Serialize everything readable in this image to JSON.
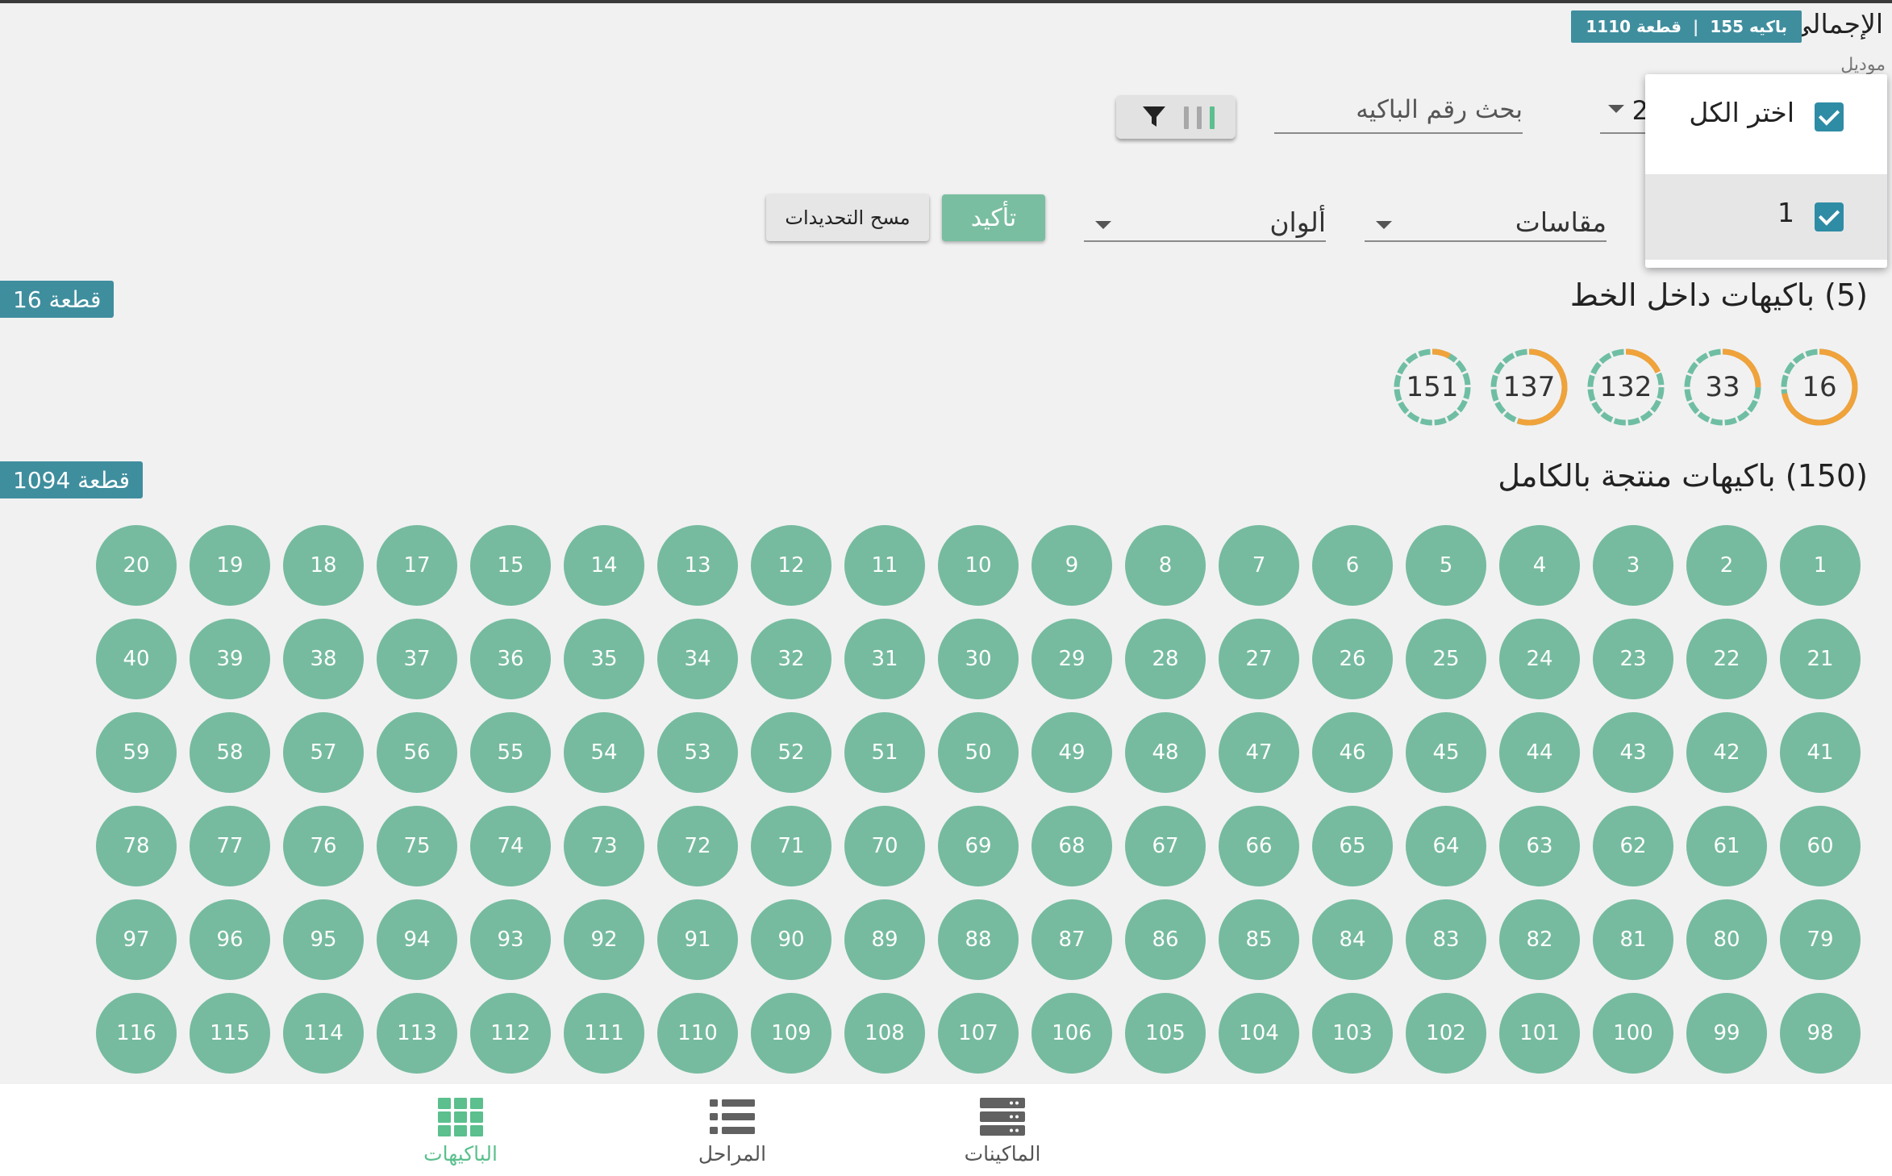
{
  "header": {
    "total_label": "الإجمالى",
    "total_batches": "155 باكيه",
    "total_pieces": "1110 قطعة",
    "model_label": "موديل"
  },
  "filters": {
    "model_value": "2",
    "search_placeholder": "بحث رقم الباكيه",
    "sizes_label": "مقاسات",
    "colors_label": "ألوان",
    "confirm_label": "تأكيد",
    "clear_label": "مسح التحديدات"
  },
  "popup": {
    "items": [
      {
        "label": "اختر الكل",
        "checked": true
      },
      {
        "label": "1",
        "checked": true
      }
    ]
  },
  "inline_section": {
    "title": "(5) باكيهات داخل الخط",
    "pieces": "16 قطعة",
    "batches": [
      {
        "number": "16",
        "progress": 0.72
      },
      {
        "number": "33",
        "progress": 0.25
      },
      {
        "number": "132",
        "progress": 0.18
      },
      {
        "number": "137",
        "progress": 0.55
      },
      {
        "number": "151",
        "progress": 0.08
      }
    ]
  },
  "complete_section": {
    "title": "(150) باكيهات منتجة بالكامل",
    "pieces": "1094 قطعة",
    "batches": [
      "1",
      "2",
      "3",
      "4",
      "5",
      "6",
      "7",
      "8",
      "9",
      "10",
      "11",
      "12",
      "13",
      "14",
      "15",
      "17",
      "18",
      "19",
      "20",
      "21",
      "22",
      "23",
      "24",
      "25",
      "26",
      "27",
      "28",
      "29",
      "30",
      "31",
      "32",
      "34",
      "35",
      "36",
      "37",
      "38",
      "39",
      "40",
      "41",
      "42",
      "43",
      "44",
      "45",
      "46",
      "47",
      "48",
      "49",
      "50",
      "51",
      "52",
      "53",
      "54",
      "55",
      "56",
      "57",
      "58",
      "59",
      "60",
      "61",
      "62",
      "63",
      "64",
      "65",
      "66",
      "67",
      "68",
      "69",
      "70",
      "71",
      "72",
      "73",
      "74",
      "75",
      "76",
      "77",
      "78",
      "79",
      "80",
      "81",
      "82",
      "83",
      "84",
      "85",
      "86",
      "87",
      "88",
      "89",
      "90",
      "91",
      "92",
      "93",
      "94",
      "95",
      "96",
      "97",
      "98",
      "99",
      "100",
      "101",
      "102",
      "103",
      "104",
      "105",
      "106",
      "107",
      "108",
      "109",
      "110",
      "111",
      "112",
      "113",
      "114",
      "115",
      "116"
    ]
  },
  "nav": {
    "items": [
      {
        "label": "الماكينات",
        "icon": "server-icon",
        "active": false
      },
      {
        "label": "المراحل",
        "icon": "list-icon",
        "active": false
      },
      {
        "label": "الباكيهات",
        "icon": "grid-icon",
        "active": true
      }
    ]
  },
  "colors": {
    "accent_teal": "#3f8e9e",
    "batch_green": "#76bb9f",
    "ring_orange": "#f0a23b",
    "ring_teal": "#6fbea3",
    "checkbox_blue": "#2f8ca5"
  }
}
